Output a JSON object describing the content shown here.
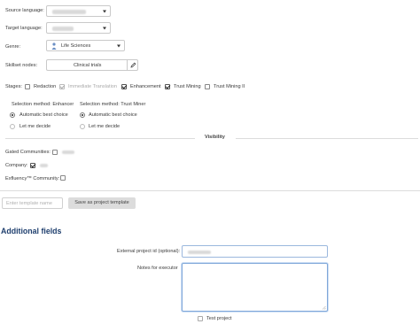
{
  "source_language": {
    "label": "Source language:",
    "value": ""
  },
  "target_language": {
    "label": "Target language:",
    "value": ""
  },
  "genre": {
    "label": "Genre:",
    "value": "Life Sciences",
    "icon": "person-icon"
  },
  "skillset": {
    "label": "Skillset nodes:",
    "value": "Clinical trials"
  },
  "stages": {
    "label": "Stages:",
    "items": [
      {
        "label": "Redaction",
        "checked": false
      },
      {
        "label": "Immediate Translation",
        "checked": true,
        "disabled": true
      },
      {
        "label": "Enhancement",
        "checked": true
      },
      {
        "label": "Trust Mining",
        "checked": true
      },
      {
        "label": "Trust Mining II",
        "checked": false
      }
    ]
  },
  "enhancer_method": {
    "title": "Selection method: Enhancer",
    "options": [
      {
        "label": "Automatic best choice",
        "selected": true
      },
      {
        "label": "Let me decide",
        "selected": false
      }
    ]
  },
  "miner_method": {
    "title": "Selection method: Trust Miner",
    "options": [
      {
        "label": "Automatic best choice",
        "selected": true
      },
      {
        "label": "Let me decide",
        "selected": false
      }
    ]
  },
  "visibility": {
    "title": "Visibility",
    "gated_label": "Gated Communities:",
    "company_label": "Company:",
    "exfluency_label": "Exfluency™ Community:"
  },
  "template": {
    "placeholder": "Enter template name",
    "save_label": "Save as project template"
  },
  "additional": {
    "heading": "Additional fields",
    "external_id_label": "External project id (optional):",
    "notes_label": "Notes for executor",
    "test_project_label": "Test project"
  },
  "colors": {
    "heading": "#1f3f6e",
    "focus_border": "#7fa7d9",
    "accent": "#1f3f6e"
  }
}
